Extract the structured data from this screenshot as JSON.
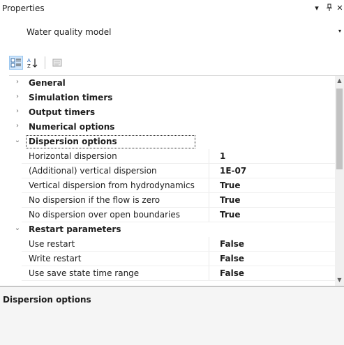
{
  "header": {
    "title": "Properties",
    "dropdown_icon": "▾",
    "pin_icon": "⊥",
    "close_icon": "✕"
  },
  "object_selector": {
    "value": "Water quality model",
    "chevron": "▾"
  },
  "toolbar": {
    "categorized_icon": "categorized-icon",
    "alphabetical_icon": "alphabetical-sort-icon",
    "property_pages_icon": "property-pages-icon"
  },
  "categories": [
    {
      "label": "General",
      "chevron": "›",
      "expanded": false
    },
    {
      "label": "Simulation timers",
      "chevron": "›",
      "expanded": false
    },
    {
      "label": "Output timers",
      "chevron": "›",
      "expanded": false
    },
    {
      "label": "Numerical options",
      "chevron": "›",
      "expanded": false
    },
    {
      "label": "Dispersion options",
      "chevron": "⌄",
      "expanded": true,
      "properties": [
        {
          "name": "Horizontal dispersion",
          "value": "1"
        },
        {
          "name": "(Additional) vertical dispersion",
          "value": "1E-07"
        },
        {
          "name": "Vertical dispersion from hydrodynamics",
          "value": "True"
        },
        {
          "name": "No dispersion if the flow is zero",
          "value": "True"
        },
        {
          "name": "No dispersion over open boundaries",
          "value": "True"
        }
      ]
    },
    {
      "label": "Restart parameters",
      "chevron": "⌄",
      "expanded": true,
      "properties": [
        {
          "name": "Use restart",
          "value": "False"
        },
        {
          "name": "Write restart",
          "value": "False"
        },
        {
          "name": "Use save state time range",
          "value": "False"
        }
      ]
    }
  ],
  "scrollbar": {
    "up": "▲",
    "down": "▼"
  },
  "help": {
    "title": "Dispersion options"
  },
  "colors": {
    "selected_toolbar": "#cfe5fb",
    "panel_bg": "#f5f5f5"
  }
}
